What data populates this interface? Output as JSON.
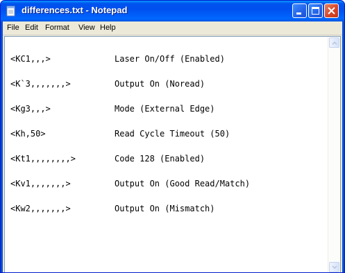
{
  "window": {
    "title": "differences.txt - Notepad",
    "icon": "notepad-icon"
  },
  "menu": {
    "items": [
      "File",
      "Edit",
      "Format",
      "View",
      "Help"
    ]
  },
  "document": {
    "lines": [
      {
        "code": "<KC1,,,>",
        "description": "Laser On/Off (Enabled)"
      },
      {
        "code": "<K`3,,,,,,,>",
        "description": "Output On (Noread)"
      },
      {
        "code": "<Kg3,,,>",
        "description": "Mode (External Edge)"
      },
      {
        "code": "<Kh,50>",
        "description": "Read Cycle Timeout (50)"
      },
      {
        "code": "<Kt1,,,,,,,,>",
        "description": "Code 128 (Enabled)"
      },
      {
        "code": "<Kv1,,,,,,,>",
        "description": "Output On (Good Read/Match)"
      },
      {
        "code": "<Kw2,,,,,,,>",
        "description": "Output On (Mismatch)"
      }
    ]
  },
  "colors": {
    "titlebar": "#0058ee",
    "close_button": "#d8462a",
    "client": "#ece9d8"
  }
}
